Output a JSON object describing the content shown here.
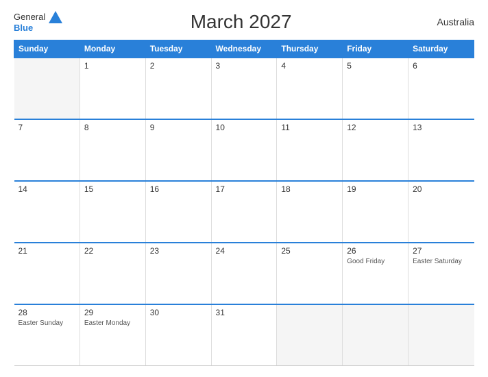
{
  "header": {
    "title": "March 2027",
    "country": "Australia",
    "logo_line1": "General",
    "logo_line2": "Blue"
  },
  "days_of_week": [
    "Sunday",
    "Monday",
    "Tuesday",
    "Wednesday",
    "Thursday",
    "Friday",
    "Saturday"
  ],
  "weeks": [
    [
      {
        "day": "",
        "holiday": ""
      },
      {
        "day": "1",
        "holiday": ""
      },
      {
        "day": "2",
        "holiday": ""
      },
      {
        "day": "3",
        "holiday": ""
      },
      {
        "day": "4",
        "holiday": ""
      },
      {
        "day": "5",
        "holiday": ""
      },
      {
        "day": "6",
        "holiday": ""
      }
    ],
    [
      {
        "day": "7",
        "holiday": ""
      },
      {
        "day": "8",
        "holiday": ""
      },
      {
        "day": "9",
        "holiday": ""
      },
      {
        "day": "10",
        "holiday": ""
      },
      {
        "day": "11",
        "holiday": ""
      },
      {
        "day": "12",
        "holiday": ""
      },
      {
        "day": "13",
        "holiday": ""
      }
    ],
    [
      {
        "day": "14",
        "holiday": ""
      },
      {
        "day": "15",
        "holiday": ""
      },
      {
        "day": "16",
        "holiday": ""
      },
      {
        "day": "17",
        "holiday": ""
      },
      {
        "day": "18",
        "holiday": ""
      },
      {
        "day": "19",
        "holiday": ""
      },
      {
        "day": "20",
        "holiday": ""
      }
    ],
    [
      {
        "day": "21",
        "holiday": ""
      },
      {
        "day": "22",
        "holiday": ""
      },
      {
        "day": "23",
        "holiday": ""
      },
      {
        "day": "24",
        "holiday": ""
      },
      {
        "day": "25",
        "holiday": ""
      },
      {
        "day": "26",
        "holiday": "Good Friday"
      },
      {
        "day": "27",
        "holiday": "Easter Saturday"
      }
    ],
    [
      {
        "day": "28",
        "holiday": "Easter Sunday"
      },
      {
        "day": "29",
        "holiday": "Easter Monday"
      },
      {
        "day": "30",
        "holiday": ""
      },
      {
        "day": "31",
        "holiday": ""
      },
      {
        "day": "",
        "holiday": ""
      },
      {
        "day": "",
        "holiday": ""
      },
      {
        "day": "",
        "holiday": ""
      }
    ]
  ]
}
